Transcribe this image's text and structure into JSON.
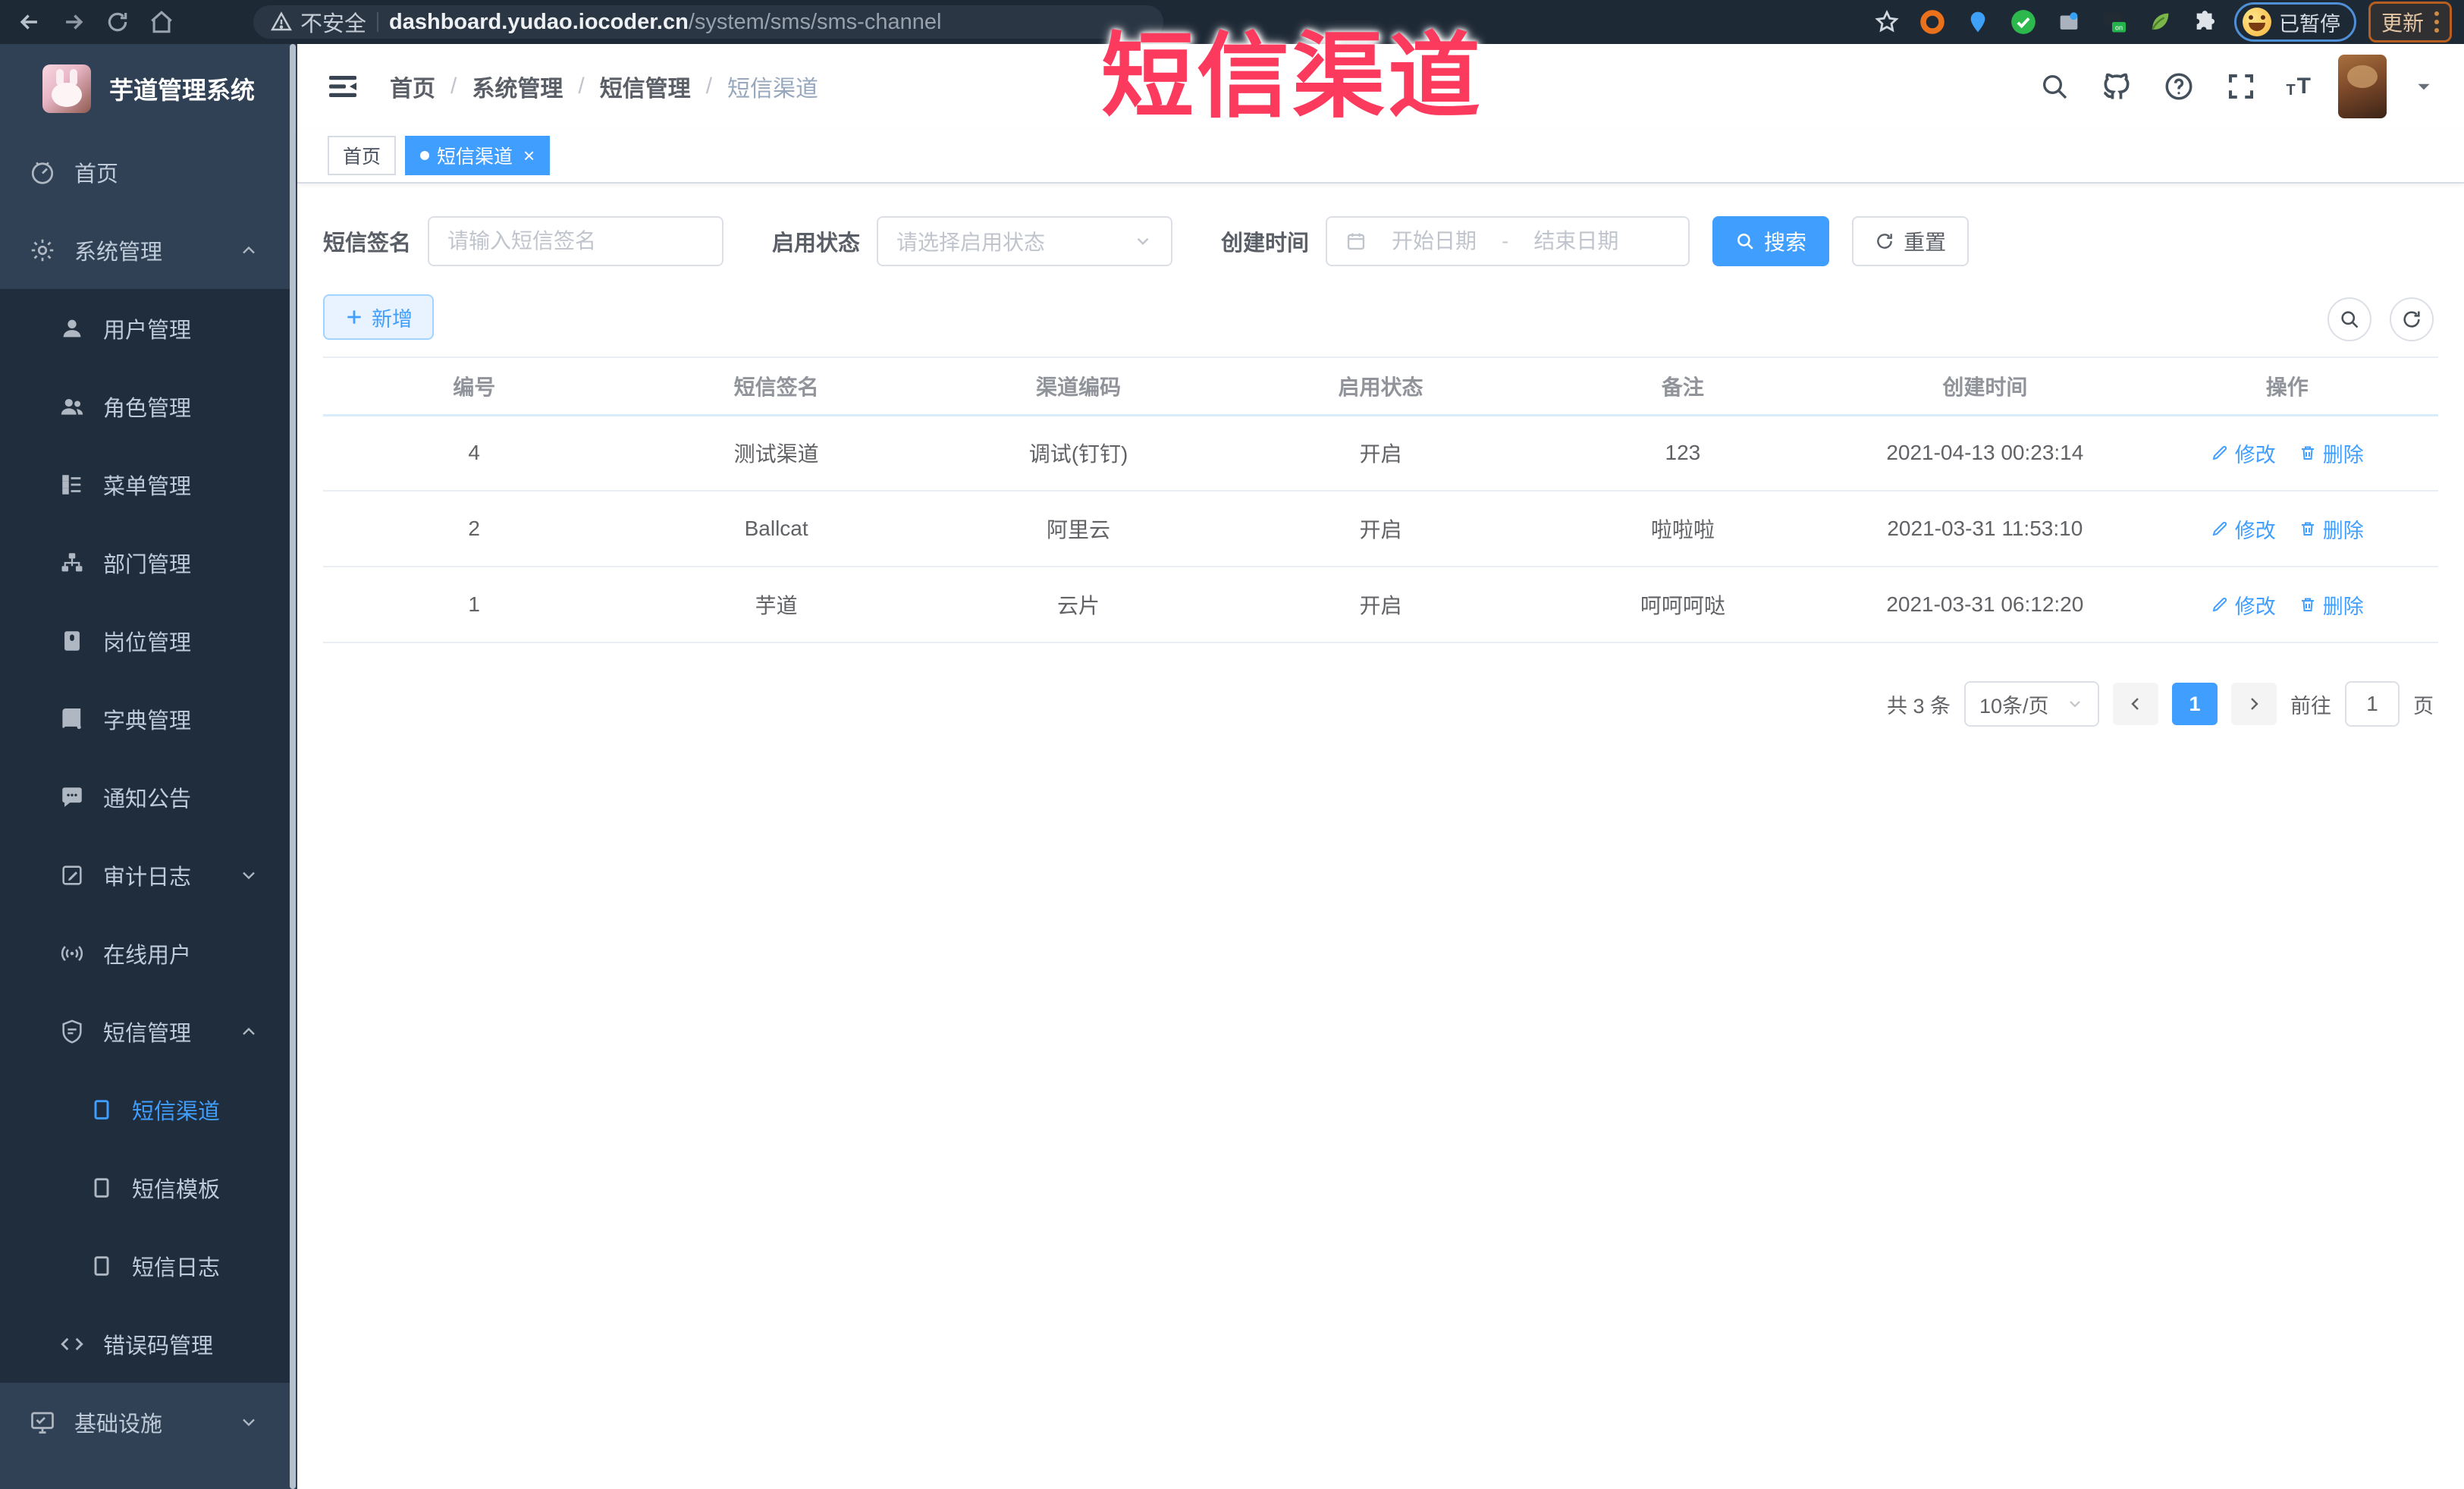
{
  "browser": {
    "security_label": "不安全",
    "url_domain": "dashboard.yudao.iocoder.cn",
    "url_path": "/system/sms/sms-channel",
    "paused_badge": "已暂停",
    "update_label": "更新"
  },
  "annotation": {
    "text": "短信渠道"
  },
  "sidebar": {
    "title": "芋道管理系统",
    "items": [
      {
        "label": "首页"
      },
      {
        "label": "系统管理"
      },
      {
        "label": "用户管理"
      },
      {
        "label": "角色管理"
      },
      {
        "label": "菜单管理"
      },
      {
        "label": "部门管理"
      },
      {
        "label": "岗位管理"
      },
      {
        "label": "字典管理"
      },
      {
        "label": "通知公告"
      },
      {
        "label": "审计日志"
      },
      {
        "label": "在线用户"
      },
      {
        "label": "短信管理"
      },
      {
        "label": "短信渠道",
        "active": true
      },
      {
        "label": "短信模板"
      },
      {
        "label": "短信日志"
      },
      {
        "label": "错误码管理"
      },
      {
        "label": "基础设施"
      }
    ]
  },
  "breadcrumb": {
    "separator": "/",
    "items": [
      "首页",
      "系统管理",
      "短信管理",
      "短信渠道"
    ]
  },
  "tabs": [
    {
      "label": "首页"
    },
    {
      "label": "短信渠道",
      "close_glyph": "×"
    }
  ],
  "filters": {
    "sign_label": "短信签名",
    "sign_placeholder": "请输入短信签名",
    "status_label": "启用状态",
    "status_placeholder": "请选择启用状态",
    "time_label": "创建时间",
    "start_placeholder": "开始日期",
    "range_separator": "-",
    "end_placeholder": "结束日期",
    "search_label": "搜索",
    "reset_label": "重置"
  },
  "toolbar": {
    "add_label": "新增"
  },
  "table": {
    "headers": [
      "编号",
      "短信签名",
      "渠道编码",
      "启用状态",
      "备注",
      "创建时间",
      "操作"
    ],
    "edit_label": "修改",
    "delete_label": "删除",
    "rows": [
      {
        "id": "4",
        "sign": "测试渠道",
        "code": "调试(钉钉)",
        "status": "开启",
        "remark": "123",
        "time": "2021-04-13 00:23:14"
      },
      {
        "id": "2",
        "sign": "Ballcat",
        "code": "阿里云",
        "status": "开启",
        "remark": "啦啦啦",
        "time": "2021-03-31 11:53:10"
      },
      {
        "id": "1",
        "sign": "芋道",
        "code": "云片",
        "status": "开启",
        "remark": "呵呵呵哒",
        "time": "2021-03-31 06:12:20"
      }
    ]
  },
  "pagination": {
    "total_text": "共 3 条",
    "page_size": "10条/页",
    "current_page": "1",
    "goto_label": "前往",
    "goto_value": "1",
    "page_unit": "页"
  },
  "colors": {
    "primary": "#409eff",
    "annotation_red": "#fb3a5d",
    "sidebar_bg": "#304156",
    "submenu_bg": "#1f2d3d",
    "browser_bg": "#1e2936"
  }
}
